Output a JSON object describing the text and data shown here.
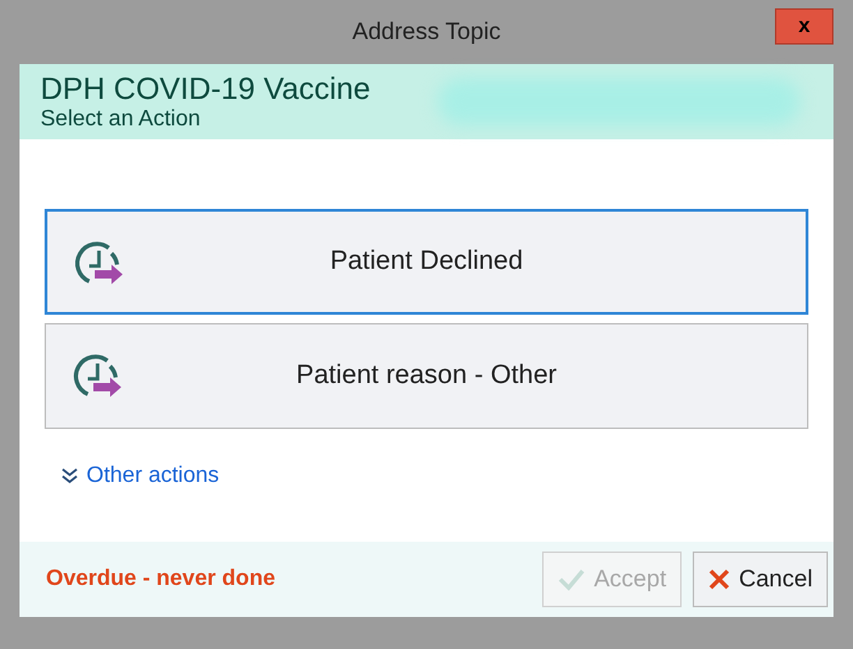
{
  "window": {
    "title": "Address Topic",
    "close": "x"
  },
  "header": {
    "title": "DPH COVID-19 Vaccine",
    "subtitle": "Select an Action"
  },
  "actions": [
    {
      "label": "Patient Declined",
      "selected": true
    },
    {
      "label": "Patient reason - Other",
      "selected": false
    }
  ],
  "more_link": {
    "label": "Other actions",
    "expanded": false
  },
  "footer": {
    "status": "Overdue - never done",
    "buttons": [
      {
        "kind": "accept",
        "label": "Accept",
        "disabled": true
      },
      {
        "kind": "cancel",
        "label": "Cancel",
        "disabled": false
      }
    ]
  }
}
